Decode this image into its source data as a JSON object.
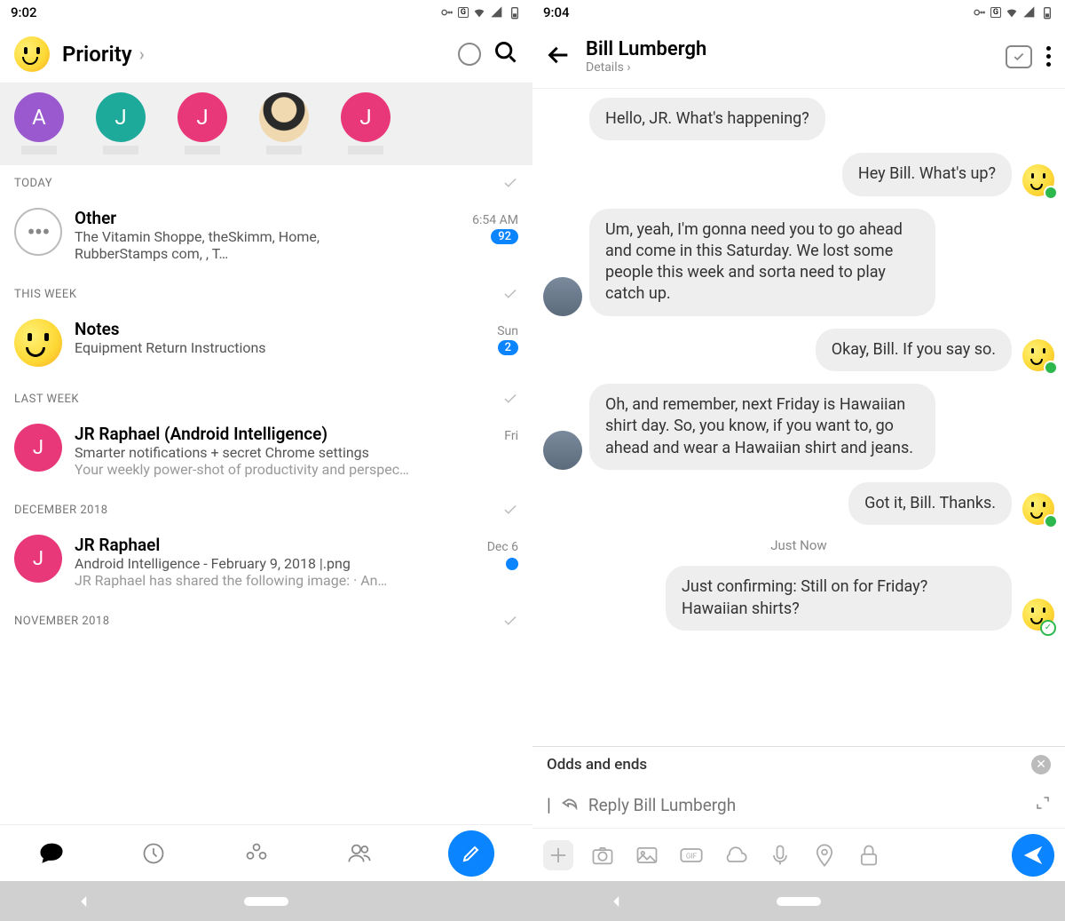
{
  "left": {
    "status_time": "9:02",
    "header_title": "Priority",
    "avatars": [
      {
        "letter": "A",
        "color": "#9b59d0"
      },
      {
        "letter": "J",
        "color": "#1eaa9a"
      },
      {
        "letter": "J",
        "color": "#e8387a"
      },
      {
        "letter": "",
        "color": "#d4c49a"
      },
      {
        "letter": "J",
        "color": "#e8387a"
      }
    ],
    "sections": [
      {
        "label": "TODAY",
        "items": [
          {
            "avatar_type": "dots",
            "title": "Other",
            "time": "6:54 AM",
            "badge": "92",
            "preview1": "The Vitamin Shoppe, theSkimm, Home,",
            "preview2": "RubberStamps com,                                 , T…"
          }
        ]
      },
      {
        "label": "THIS WEEK",
        "items": [
          {
            "avatar_type": "smiley",
            "title": "Notes",
            "time": "Sun",
            "badge": "2",
            "preview1": "Equipment Return Instructions"
          }
        ]
      },
      {
        "label": "LAST WEEK",
        "items": [
          {
            "avatar_type": "letter",
            "letter": "J",
            "color": "#e8387a",
            "title": "JR Raphael (Android Intelligence)",
            "time": "Fri",
            "preview1": "Smarter notifications + secret Chrome settings",
            "preview2_gray": "Your weekly power-shot of productivity and perspec…"
          }
        ]
      },
      {
        "label": "DECEMBER 2018",
        "items": [
          {
            "avatar_type": "letter",
            "letter": "J",
            "color": "#e8387a",
            "title": "JR Raphael",
            "time": "Dec 6",
            "dot": true,
            "preview1": "Android Intelligence - February 9, 2018 |.png",
            "preview2_gray": "JR Raphael has shared the following image: · An…"
          }
        ]
      },
      {
        "label": "NOVEMBER 2018",
        "items": []
      }
    ]
  },
  "right": {
    "status_time": "9:04",
    "contact_name": "Bill Lumbergh",
    "details_label": "Details",
    "messages": [
      {
        "dir": "in",
        "text": "Hello, JR. What's happening?",
        "no_avatar": true
      },
      {
        "dir": "out",
        "text": "Hey Bill. What's up?",
        "read": true
      },
      {
        "dir": "in",
        "text": "Um, yeah, I'm gonna need you to go ahead and come in this Saturday. We lost some people this week and sorta need to play catch up."
      },
      {
        "dir": "out",
        "text": "Okay, Bill. If you say so.",
        "read": true
      },
      {
        "dir": "in",
        "text": "Oh, and remember, next Friday is Hawaiian shirt day. So, you know, if you want to, go ahead and wear a Hawaiian shirt and jeans."
      },
      {
        "dir": "out",
        "text": "Got it, Bill. Thanks.",
        "read": true
      },
      {
        "timestamp": "Just Now"
      },
      {
        "dir": "out",
        "text": "Just confirming: Still on for Friday? Hawaiian shirts?",
        "pending": true
      }
    ],
    "suggestion": "Odds and ends",
    "reply_placeholder": "Reply Bill Lumbergh"
  }
}
